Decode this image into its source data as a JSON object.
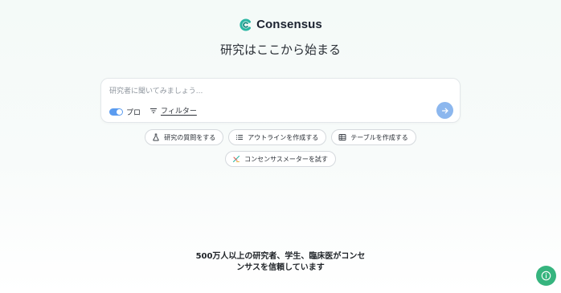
{
  "brand": {
    "name": "Consensus",
    "accent_color": "#2bb6a3",
    "icon": "consensus-logo-icon"
  },
  "headline": "研究はここから始まる",
  "search": {
    "placeholder": "研究者に聞いてみましょう...",
    "pro_label": "プロ",
    "pro_enabled": true,
    "filter_label": "フィルター",
    "filter_icon": "filter-lines-icon",
    "submit_icon": "arrow-right-icon",
    "submit_color": "#8cb7ee"
  },
  "suggestions": [
    {
      "label": "研究の質問をする",
      "icon": "flask-icon"
    },
    {
      "label": "アウトラインを作成する",
      "icon": "list-icon"
    },
    {
      "label": "テーブルを作成する",
      "icon": "table-icon"
    },
    {
      "label": "コンセンサスメーターを試す",
      "icon": "consensus-meter-icon"
    }
  ],
  "tagline": {
    "line1": "500万人以上の研究者、学生、臨床医がコンセ",
    "line2": "ンサスを信頼しています"
  },
  "help": {
    "icon": "info-circle-icon",
    "color": "#36b47e"
  }
}
